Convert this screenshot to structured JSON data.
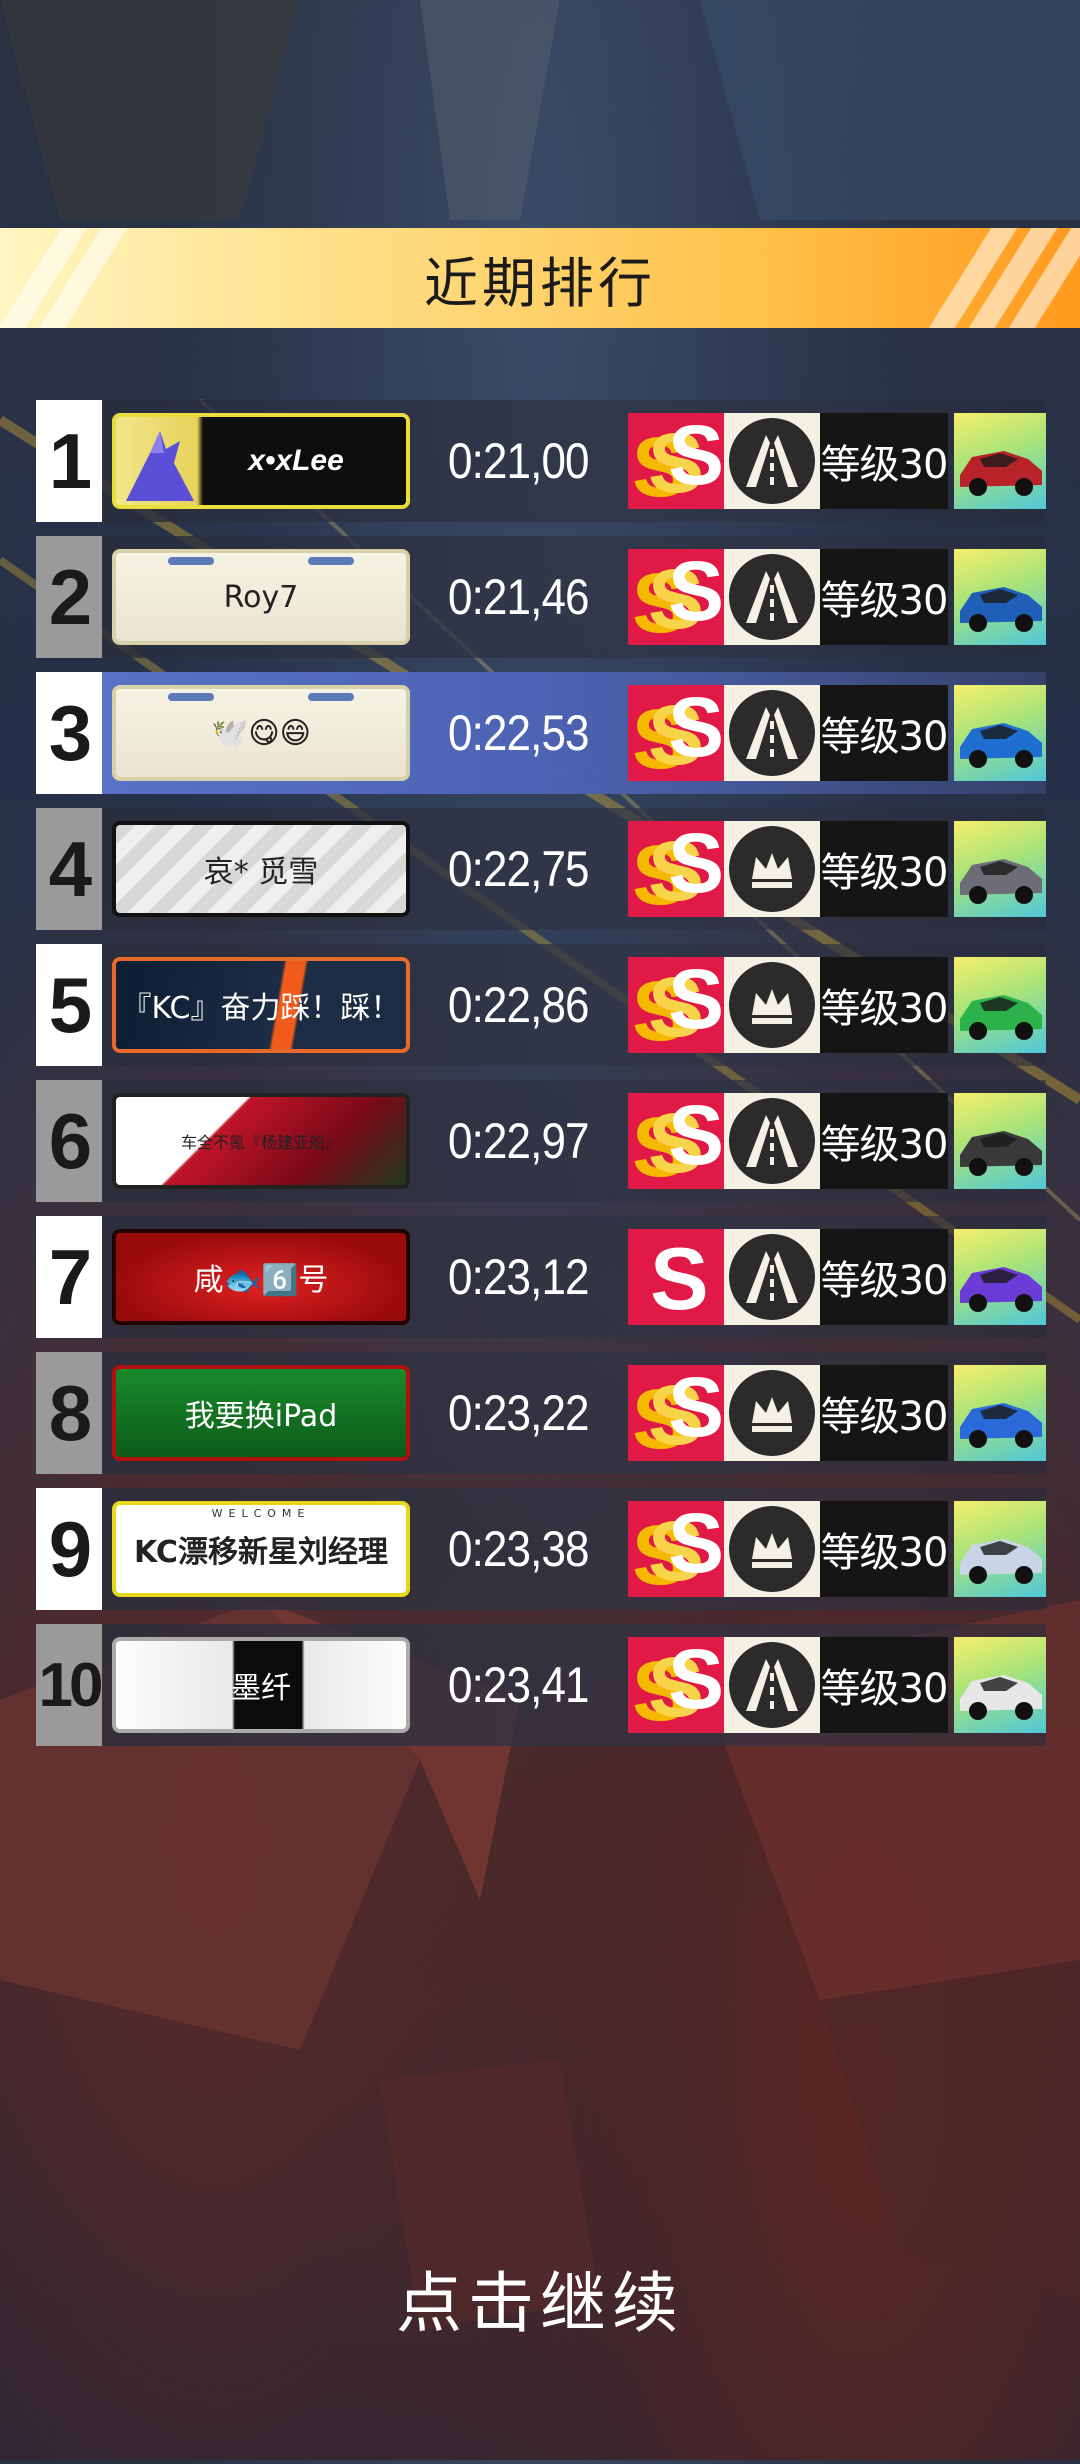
{
  "header": {
    "title": "近期排行"
  },
  "leaderboard": [
    {
      "rank": "1",
      "name": "x•xLee",
      "time": "0:21,00",
      "level": "等级30",
      "crown": false,
      "single_s": false,
      "plate_style": "wolf",
      "car_color": "#b8232a"
    },
    {
      "rank": "2",
      "name": "Roy7",
      "time": "0:21,46",
      "level": "等级30",
      "crown": false,
      "single_s": false,
      "plate_style": "plain",
      "car_color": "#1f5fb8"
    },
    {
      "rank": "3",
      "name": "🕊️😋😄",
      "time": "0:22,53",
      "level": "等级30",
      "crown": false,
      "single_s": false,
      "plate_style": "plain",
      "car_color": "#1f6fd0",
      "highlight": true
    },
    {
      "rank": "4",
      "name": "哀* 觅雪",
      "time": "0:22,75",
      "level": "等级30",
      "crown": true,
      "single_s": false,
      "plate_style": "green",
      "car_color": "#6d6d78"
    },
    {
      "rank": "5",
      "name": "『KC』奋力踩！踩！",
      "time": "0:22,86",
      "level": "等级30",
      "crown": true,
      "single_s": false,
      "plate_style": "orange",
      "car_color": "#2bb24a"
    },
    {
      "rank": "6",
      "name": "车全不氪『杨建亚船』",
      "time": "0:22,97",
      "level": "等级30",
      "crown": false,
      "single_s": false,
      "plate_style": "sakura",
      "car_color": "#3a3a3a"
    },
    {
      "rank": "7",
      "name": "咸🐟6️⃣号",
      "time": "0:23,12",
      "level": "等级30",
      "crown": false,
      "single_s": true,
      "plate_style": "red",
      "car_color": "#6a3bd6"
    },
    {
      "rank": "8",
      "name": "我要换iPad",
      "time": "0:23,22",
      "level": "等级30",
      "crown": true,
      "single_s": false,
      "plate_style": "xmas",
      "car_color": "#2a6ad8"
    },
    {
      "rank": "9",
      "name": "KC漂移新星刘经理",
      "time": "0:23,38",
      "level": "等级30",
      "crown": true,
      "single_s": false,
      "plate_style": "welcome",
      "car_color": "#c9d4e6"
    },
    {
      "rank": "10",
      "name": "墨纤",
      "time": "0:23,41",
      "level": "等级30",
      "crown": false,
      "single_s": false,
      "plate_style": "white",
      "car_color": "#e7e7e7"
    }
  ],
  "plate_extras": {
    "welcome_text": "WELCOME"
  },
  "footer": {
    "continue_label": "点击继续"
  },
  "colors": {
    "banner_start": "#fff6c2",
    "banner_end": "#ff9a1e",
    "s_badge": "#e01946",
    "highlight_row": "#5a74c9"
  }
}
